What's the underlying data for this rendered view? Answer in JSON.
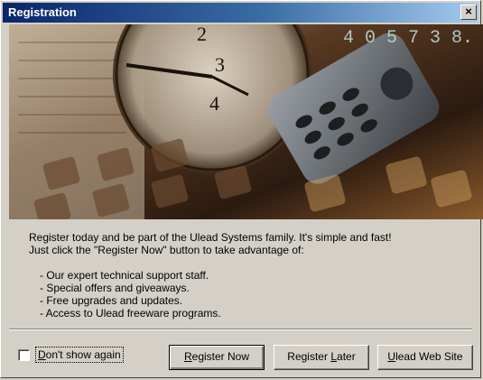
{
  "window": {
    "title": "Registration",
    "close_label": "×"
  },
  "banner": {
    "digital_readout": "4 0 5 7 3 8."
  },
  "body_text": {
    "line1": "Register today and be part of the Ulead Systems family.  It's simple and fast!",
    "line2": "Just click the \"Register Now\" button to take advantage of:",
    "bullets": [
      "- Our expert technical support staff.",
      "- Special offers and giveaways.",
      "- Free upgrades and updates.",
      "- Access to Ulead freeware programs."
    ]
  },
  "footer": {
    "checkbox_label_pre": "",
    "checkbox_label_ul": "D",
    "checkbox_label_post": "on't show again",
    "checkbox_checked": false,
    "register_now": {
      "pre": "",
      "ul": "R",
      "post": "egister Now"
    },
    "register_later": {
      "pre": "Register ",
      "ul": "L",
      "post": "ater"
    },
    "web_site": {
      "pre": "",
      "ul": "U",
      "post": "lead Web Site"
    }
  }
}
